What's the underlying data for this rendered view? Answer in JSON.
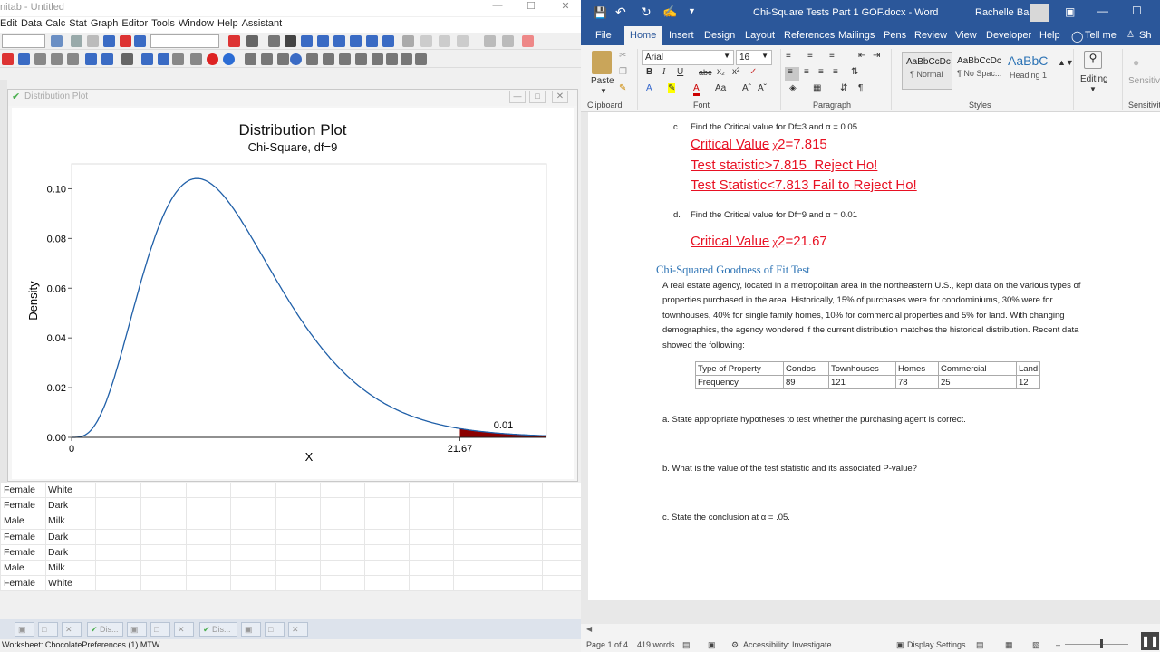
{
  "minitab": {
    "title": "nitab - Untitled",
    "menu": [
      "Edit",
      "Data",
      "Calc",
      "Stat",
      "Graph",
      "Editor",
      "Tools",
      "Window",
      "Help",
      "Assistant"
    ],
    "plot_window_title": "Distribution Plot",
    "worksheet_rows": [
      {
        "gender": "Female",
        "pref": "White"
      },
      {
        "gender": "Female",
        "pref": "Dark"
      },
      {
        "gender": "Male",
        "pref": "Milk"
      },
      {
        "gender": "Female",
        "pref": "Dark"
      },
      {
        "gender": "Female",
        "pref": "Dark"
      },
      {
        "gender": "Male",
        "pref": "Milk"
      },
      {
        "gender": "Female",
        "pref": "White"
      }
    ],
    "tabs": [
      "Dis...",
      "Dis..."
    ],
    "status": "Worksheet: ChocolatePreferences (1).MTW"
  },
  "chart_data": {
    "type": "line",
    "title": "Distribution Plot",
    "subtitle": "Chi-Square, df=9",
    "xlabel": "X",
    "ylabel": "Density",
    "xlim": [
      0,
      26.5
    ],
    "ylim": [
      0,
      0.11
    ],
    "yticks": [
      "0.00",
      "0.02",
      "0.04",
      "0.06",
      "0.08",
      "0.10"
    ],
    "xticks": [
      "0",
      "21.67"
    ],
    "df": 9,
    "critical_x": 21.67,
    "shaded_area_label": "0.01",
    "colors": {
      "curve": "#1f5fa8",
      "shade": "#8b0000"
    }
  },
  "word": {
    "title": "Chi-Square Tests Part 1 GOF.docx - Word",
    "user": "Rachelle Barr",
    "tabs": [
      "File",
      "Home",
      "Insert",
      "Design",
      "Layout",
      "References",
      "Mailings",
      "Pens",
      "Review",
      "View",
      "Developer",
      "Help",
      "Tell me",
      "Sh"
    ],
    "font_name": "Arial",
    "font_size": "16",
    "styles": [
      {
        "sample": "AaBbCcDc",
        "name": "¶ Normal"
      },
      {
        "sample": "AaBbCcDc",
        "name": "¶ No Spac..."
      },
      {
        "sample": "AaBbC",
        "name": "Heading 1"
      }
    ],
    "groups": [
      "Clipboard",
      "Font",
      "Paragraph",
      "Styles",
      "Sensitivity"
    ],
    "paste": "Paste",
    "editing": "Editing",
    "sensitivity": "Sensitivity",
    "doc": {
      "c_label": "c.",
      "c_text": "Find the Critical value for Df=3 and α = 0.05",
      "c_cv_prefix": "Critical Value",
      "c_chi": "χ",
      "c_cv_value": "2=7.815",
      "c_line2": "Test statistic>7.815  Reject Ho!",
      "c_line3": "Test Statistic<7.813 Fail to Reject Ho!",
      "d_label": "d.",
      "d_text": "Find the Critical value for Df=9 and α = 0.01",
      "d_cv_prefix": "Critical Value",
      "d_chi": "χ",
      "d_cv_value": "2=21.67",
      "heading": "Chi-Squared Goodness of Fit Test",
      "para": "A real estate agency, located in a metropolitan area in the northeastern U.S., kept data on the various types of properties purchased in the area. Historically, 15% of purchases were for condominiums, 30% were for townhouses, 40% for single family homes, 10% for commercial properties and 5% for land. With changing demographics, the agency wondered if the current distribution matches the historical distribution. Recent data showed the following:",
      "table_head": [
        "Type of Property",
        "Condos",
        "Townhouses",
        "Homes",
        "Commercial",
        "Land"
      ],
      "table_row": [
        "Frequency",
        "89",
        "121",
        "78",
        "25",
        "12"
      ],
      "qa": "a. State appropriate hypotheses to test whether the purchasing agent is correct.",
      "qb": "b. What is the value of the test statistic and its associated P-value?",
      "qc": "c. State the conclusion at α = .05."
    },
    "status": {
      "page": "Page 1 of 4",
      "words": "419 words",
      "accessibility": "Accessibility: Investigate",
      "display": "Display Settings"
    }
  }
}
